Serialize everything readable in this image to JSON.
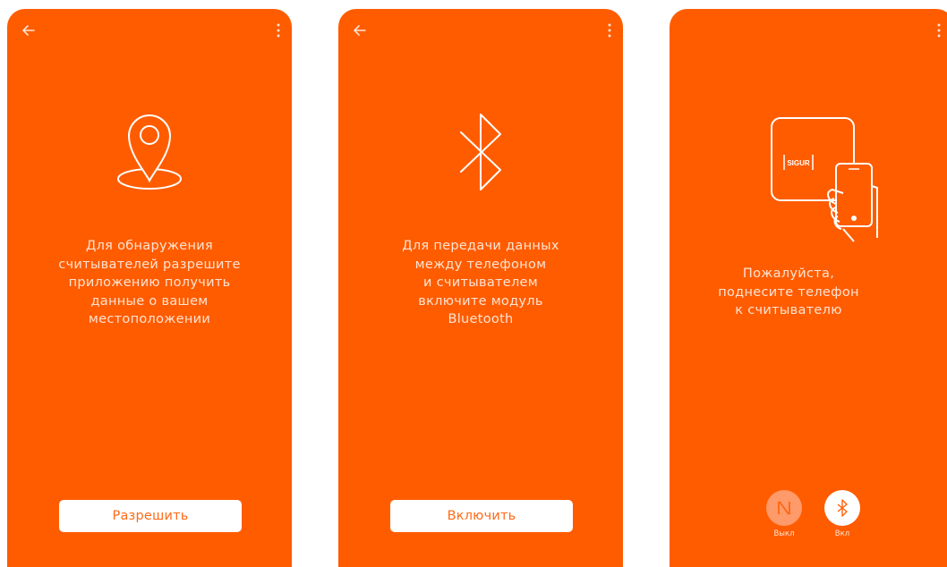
{
  "screens": [
    {
      "icon": "location-pin-icon",
      "message": "Для обнаружения\nсчитывателей разрешите\nприложению получить\nданные о вашем\nместоположении",
      "button_label": "Разрешить"
    },
    {
      "icon": "bluetooth-icon",
      "message": "Для передачи данных\nмежду телефоном\nи считывателем\nвключите модуль\nBluetooth",
      "button_label": "Включить"
    },
    {
      "icon": "phone-to-reader-icon",
      "reader_brand": "SIGUR",
      "message": "Пожалуйста,\nподнесите телефон\nк считывателю",
      "toggles": [
        {
          "icon": "nfc-icon",
          "label": "Выкл",
          "state": "off"
        },
        {
          "icon": "bluetooth-icon",
          "label": "Вкл",
          "state": "on"
        }
      ]
    }
  ],
  "colors": {
    "background": "#ff5c00",
    "text": "#ffe3d2",
    "button_bg": "#ffffff",
    "button_text": "#ff6a16",
    "toggle_off": "#ff9a6a"
  }
}
